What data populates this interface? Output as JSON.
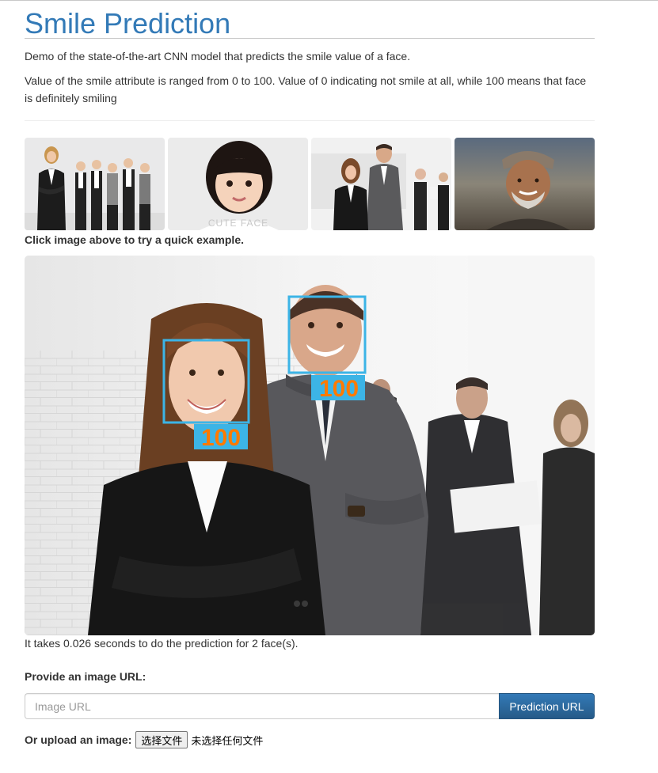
{
  "page": {
    "title": "Smile Prediction",
    "description_1": "Demo of the state-of-the-art CNN model that predicts the smile value of a face.",
    "description_2": "Value of the smile attribute is ranged from 0 to 100. Value of 0 indicating not smile at all, while 100 means that face is definitely smiling"
  },
  "examples": {
    "hint": "Click image above to try a quick example.",
    "thumbnails": [
      {
        "icon": "business-team-photo"
      },
      {
        "icon": "child-portrait-photo",
        "watermark": "CUTE FACE"
      },
      {
        "icon": "business-people-photo"
      },
      {
        "icon": "elderly-man-photo"
      }
    ]
  },
  "result": {
    "faces": [
      {
        "score": "100"
      },
      {
        "score": "100"
      }
    ],
    "box_color": "#3cb4e6",
    "score_color": "#ff7a00",
    "timing_text": "It takes 0.026 seconds to do the prediction for 2 face(s)."
  },
  "url_form": {
    "label": "Provide an image URL:",
    "placeholder": "Image URL",
    "button_label": "Prediction URL"
  },
  "upload_form": {
    "label": "Or upload an image:",
    "button_label": "选择文件",
    "no_file_text": "未选择任何文件"
  }
}
